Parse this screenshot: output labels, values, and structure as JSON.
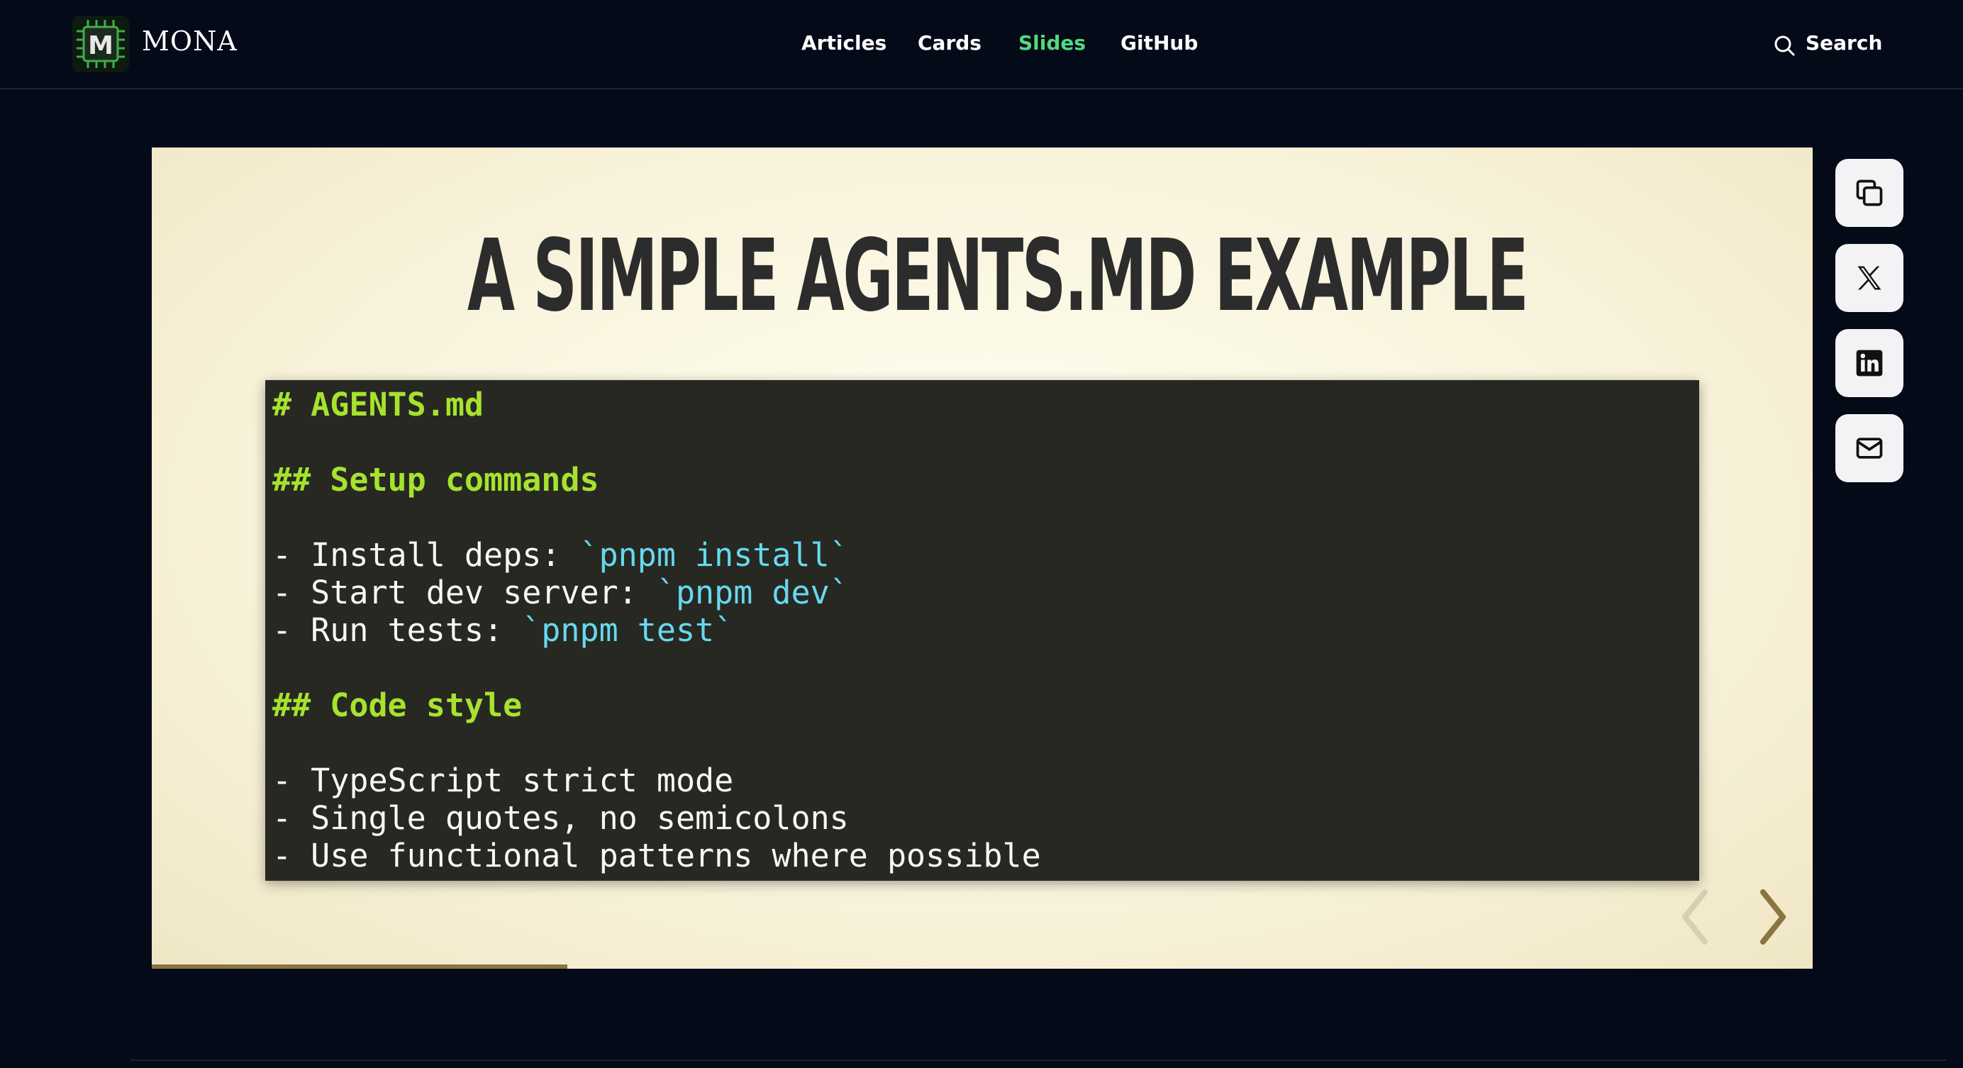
{
  "brand": {
    "name": "MONA",
    "logo_letter": "M"
  },
  "nav": {
    "items": [
      {
        "label": "Articles",
        "active": false
      },
      {
        "label": "Cards",
        "active": false
      },
      {
        "label": "Slides",
        "active": true
      },
      {
        "label": "GitHub",
        "active": false
      }
    ]
  },
  "search": {
    "label": "Search"
  },
  "slide": {
    "title": "A SIMPLE AGENTS.MD EXAMPLE",
    "code": {
      "line1": "# AGENTS.md",
      "line3": "## Setup commands",
      "line5_text": "- Install deps: ",
      "line5_code": "`pnpm install`",
      "line6_text": "- Start dev server: ",
      "line6_code": "`pnpm dev`",
      "line7_text": "- Run tests: ",
      "line7_code": "`pnpm test`",
      "line9": "## Code style",
      "line11": "- TypeScript strict mode",
      "line12": "- Single quotes, no semicolons",
      "line13": "- Use functional patterns where possible"
    },
    "progress_fraction": 0.25
  },
  "share": [
    "copy-icon",
    "x-icon",
    "linkedin-icon",
    "mail-icon"
  ],
  "colors": {
    "background": "#050a19",
    "nav_active": "#52d97c",
    "code_bg": "#272822",
    "code_heading": "#a6e22e",
    "code_inline": "#66d9ef",
    "slide_accent": "#8a7441"
  }
}
